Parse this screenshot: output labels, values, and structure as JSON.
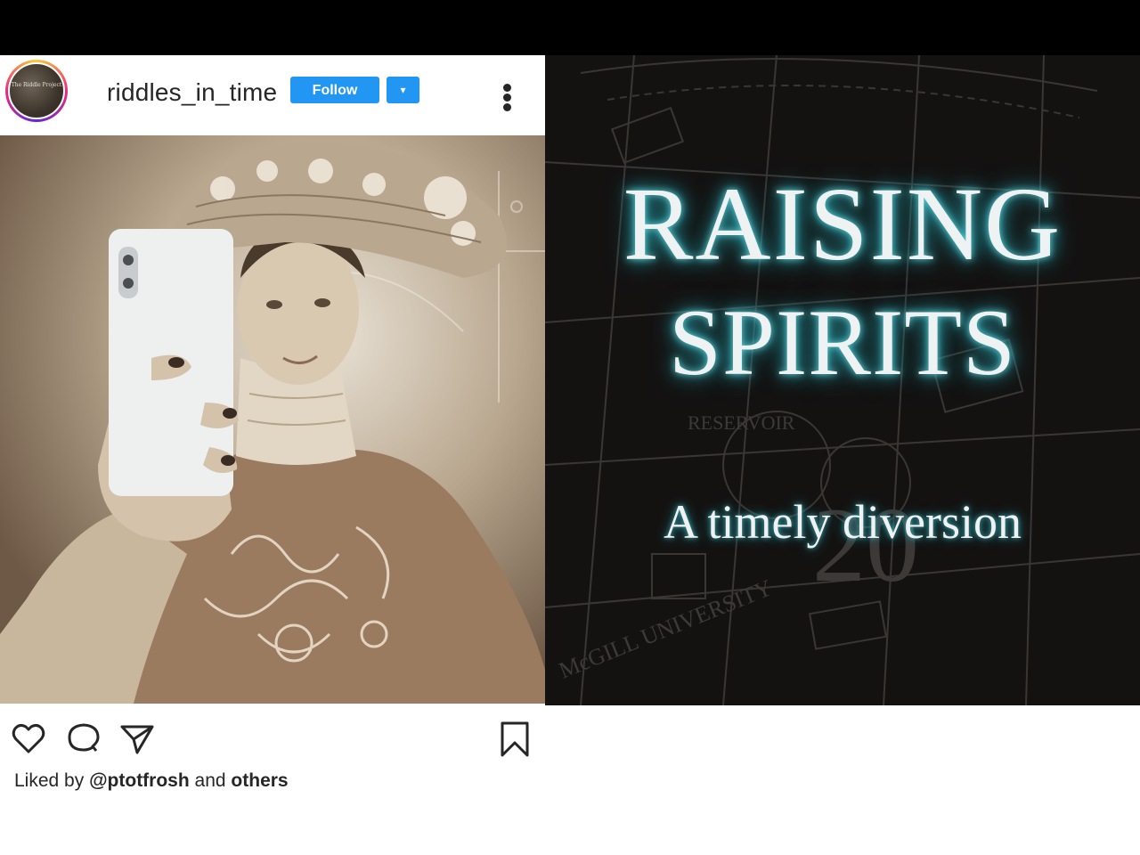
{
  "post": {
    "avatar_text": "The Riddle Project",
    "username": "riddles_in_time",
    "follow_label": "Follow",
    "dropdown_glyph": "▾",
    "icons": [
      "heart-icon",
      "comment-icon",
      "share-icon",
      "bookmark-icon"
    ],
    "likes": {
      "prefix": "Liked by",
      "user": "@ptotfrosh",
      "middle": "and",
      "suffix": "others"
    }
  },
  "poster": {
    "title_line1": "RAISING",
    "title_line2": "SPIRITS",
    "tagline": "A timely diversion",
    "map_labels": [
      "RESERVOIR",
      "McGILL UNIVERSITY",
      "20"
    ]
  },
  "colors": {
    "follow_blue": "#2196f3",
    "glow_teal": "#2aa8b4",
    "poster_bg": "#141211"
  }
}
